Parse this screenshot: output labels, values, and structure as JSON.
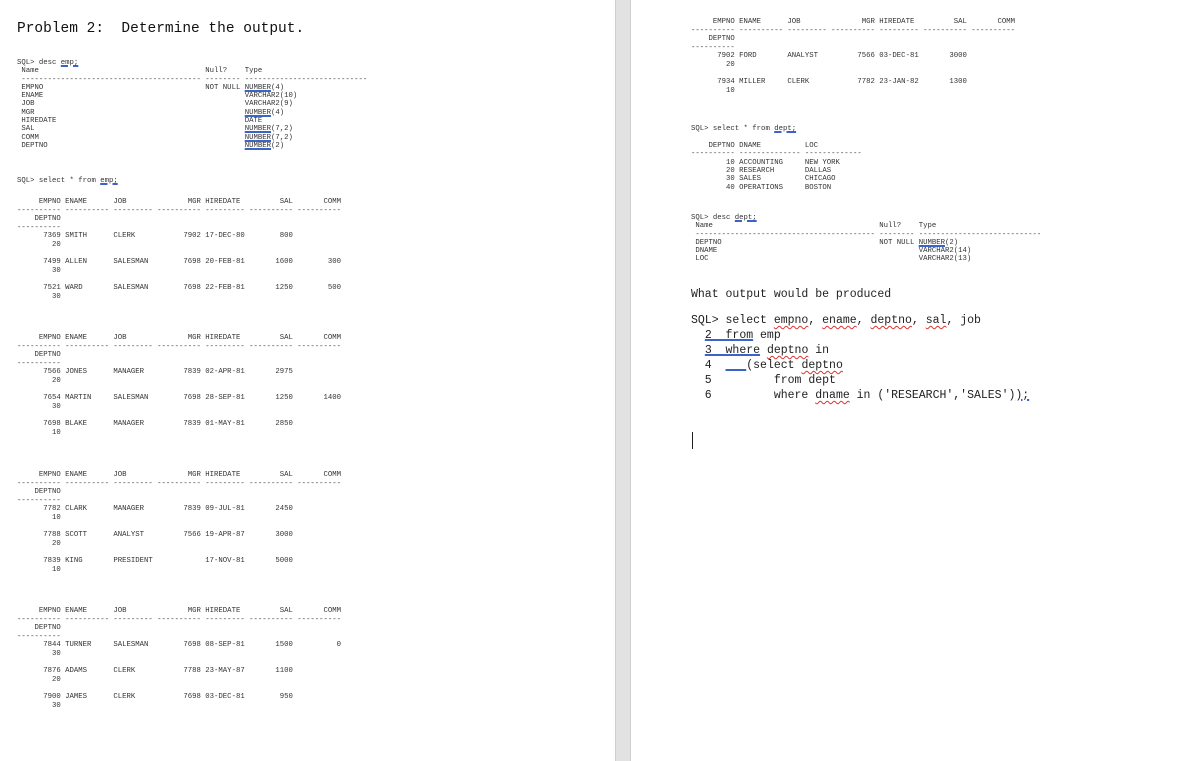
{
  "problem_title": "Problem 2:  Determine the output.",
  "desc_emp": {
    "command_prefix": "SQL> desc ",
    "command_table": "emp;",
    "header_name": "Name",
    "header_null": "Null?",
    "header_type": "Type",
    "columns": [
      {
        "name": "EMPNO",
        "null": "NOT NULL",
        "type_base": "NUMBER",
        "type_args": "(4)",
        "flagged": true
      },
      {
        "name": "ENAME",
        "null": "",
        "type_base": "VARCHAR2",
        "type_args": "(10)",
        "flagged": false
      },
      {
        "name": "JOB",
        "null": "",
        "type_base": "VARCHAR2",
        "type_args": "(9)",
        "flagged": false
      },
      {
        "name": "MGR",
        "null": "",
        "type_base": "NUMBER",
        "type_args": "(4)",
        "flagged": true
      },
      {
        "name": "HIREDATE",
        "null": "",
        "type_base": "DATE",
        "type_args": "",
        "flagged": false
      },
      {
        "name": "SAL",
        "null": "",
        "type_base": "NUMBER",
        "type_args": "(7,2)",
        "flagged": true
      },
      {
        "name": "COMM",
        "null": "",
        "type_base": "NUMBER",
        "type_args": "(7,2)",
        "flagged": true
      },
      {
        "name": "DEPTNO",
        "null": "",
        "type_base": "NUMBER",
        "type_args": "(2)",
        "flagged": true
      }
    ]
  },
  "select_emp": {
    "command_prefix": "SQL> select * from ",
    "command_table": "emp;",
    "headers": [
      "EMPNO",
      "ENAME",
      "JOB",
      "MGR",
      "HIREDATE",
      "SAL",
      "COMM",
      "DEPTNO"
    ],
    "pages": [
      [
        {
          "empno": "7369",
          "ename": "SMITH",
          "job": "CLERK",
          "mgr": "7902",
          "hiredate": "17-DEC-80",
          "sal": "800",
          "comm": "",
          "deptno": "20"
        },
        {
          "empno": "7499",
          "ename": "ALLEN",
          "job": "SALESMAN",
          "mgr": "7698",
          "hiredate": "20-FEB-81",
          "sal": "1600",
          "comm": "300",
          "deptno": "30"
        },
        {
          "empno": "7521",
          "ename": "WARD",
          "job": "SALESMAN",
          "mgr": "7698",
          "hiredate": "22-FEB-81",
          "sal": "1250",
          "comm": "500",
          "deptno": "30"
        }
      ],
      [
        {
          "empno": "7566",
          "ename": "JONES",
          "job": "MANAGER",
          "mgr": "7839",
          "hiredate": "02-APR-81",
          "sal": "2975",
          "comm": "",
          "deptno": "20"
        },
        {
          "empno": "7654",
          "ename": "MARTIN",
          "job": "SALESMAN",
          "mgr": "7698",
          "hiredate": "28-SEP-81",
          "sal": "1250",
          "comm": "1400",
          "deptno": "30"
        },
        {
          "empno": "7698",
          "ename": "BLAKE",
          "job": "MANAGER",
          "mgr": "7839",
          "hiredate": "01-MAY-81",
          "sal": "2850",
          "comm": "",
          "deptno": "10"
        }
      ],
      [
        {
          "empno": "7782",
          "ename": "CLARK",
          "job": "MANAGER",
          "mgr": "7839",
          "hiredate": "09-JUL-81",
          "sal": "2450",
          "comm": "",
          "deptno": "10"
        },
        {
          "empno": "7788",
          "ename": "SCOTT",
          "job": "ANALYST",
          "mgr": "7566",
          "hiredate": "19-APR-87",
          "sal": "3000",
          "comm": "",
          "deptno": "20"
        },
        {
          "empno": "7839",
          "ename": "KING",
          "job": "PRESIDENT",
          "mgr": "",
          "hiredate": "17-NOV-81",
          "sal": "5000",
          "comm": "",
          "deptno": "10"
        }
      ],
      [
        {
          "empno": "7844",
          "ename": "TURNER",
          "job": "SALESMAN",
          "mgr": "7698",
          "hiredate": "08-SEP-81",
          "sal": "1500",
          "comm": "0",
          "deptno": "30"
        },
        {
          "empno": "7876",
          "ename": "ADAMS",
          "job": "CLERK",
          "mgr": "7788",
          "hiredate": "23-MAY-87",
          "sal": "1100",
          "comm": "",
          "deptno": "20"
        },
        {
          "empno": "7900",
          "ename": "JAMES",
          "job": "CLERK",
          "mgr": "7698",
          "hiredate": "03-DEC-81",
          "sal": "950",
          "comm": "",
          "deptno": "30"
        }
      ],
      [
        {
          "empno": "7902",
          "ename": "FORD",
          "job": "ANALYST",
          "mgr": "7566",
          "hiredate": "03-DEC-81",
          "sal": "3000",
          "comm": "",
          "deptno": "20"
        },
        {
          "empno": "7934",
          "ename": "MILLER",
          "job": "CLERK",
          "mgr": "7782",
          "hiredate": "23-JAN-82",
          "sal": "1300",
          "comm": "",
          "deptno": "10"
        }
      ]
    ]
  },
  "select_dept": {
    "command_prefix": "SQL> select * from ",
    "command_table": "dept;",
    "headers": [
      "DEPTNO",
      "DNAME",
      "LOC"
    ],
    "rows": [
      {
        "deptno": "10",
        "dname": "ACCOUNTING",
        "loc": "NEW YORK"
      },
      {
        "deptno": "20",
        "dname": "RESEARCH",
        "loc": "DALLAS"
      },
      {
        "deptno": "30",
        "dname": "SALES",
        "loc": "CHICAGO"
      },
      {
        "deptno": "40",
        "dname": "OPERATIONS",
        "loc": "BOSTON"
      }
    ]
  },
  "desc_dept": {
    "command_prefix": "SQL> desc ",
    "command_table": "dept;",
    "header_name": "Name",
    "header_null": "Null?",
    "header_type": "Type",
    "columns": [
      {
        "name": "DEPTNO",
        "null": "NOT NULL",
        "type_base": "NUMBER",
        "type_args": "(2)",
        "flagged": true
      },
      {
        "name": "DNAME",
        "null": "",
        "type_base": "VARCHAR2",
        "type_args": "(14)",
        "flagged": false
      },
      {
        "name": "LOC",
        "null": "",
        "type_base": "VARCHAR2",
        "type_args": "(13)",
        "flagged": false
      }
    ]
  },
  "question": "What output would be produced",
  "query_lines": [
    "SQL> select empno, ename, deptno, sal, job",
    "  2  from emp",
    "  3  where deptno in",
    "  4      (select deptno",
    "  5         from dept",
    "  6         where dname in ('RESEARCH','SALES'));"
  ]
}
